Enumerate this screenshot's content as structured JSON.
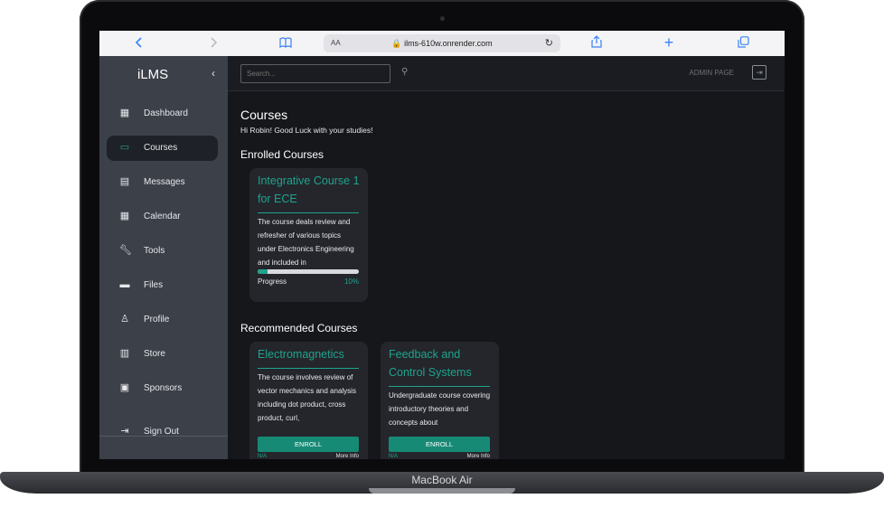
{
  "device": {
    "brand_label": "MacBook Air"
  },
  "browser": {
    "back_icon": "chevron-left-icon",
    "forward_icon": "chevron-right-icon",
    "bookmarks_icon": "book-icon",
    "text_size_label": "AA",
    "url": "🔒 ilms-610w.onrender.com",
    "reload_icon": "reload-icon",
    "share_icon": "share-icon",
    "new_tab_icon": "plus-icon",
    "tabs_icon": "tabs-icon"
  },
  "sidebar": {
    "logo": "iLMS",
    "collapse_icon": "chevron-left-icon",
    "items": [
      {
        "label": "Dashboard",
        "icon": "dashboard-icon"
      },
      {
        "label": "Courses",
        "icon": "book-icon",
        "active": true
      },
      {
        "label": "Messages",
        "icon": "message-icon"
      },
      {
        "label": "Calendar",
        "icon": "calendar-icon"
      },
      {
        "label": "Tools",
        "icon": "wrench-icon"
      },
      {
        "label": "Files",
        "icon": "folder-icon"
      },
      {
        "label": "Profile",
        "icon": "user-icon"
      },
      {
        "label": "Store",
        "icon": "store-icon"
      },
      {
        "label": "Sponsors",
        "icon": "sponsor-icon"
      }
    ],
    "sign_out": {
      "label": "Sign Out",
      "icon": "sign-out-icon"
    }
  },
  "topbar": {
    "search_placeholder": "Search...",
    "admin_label": "ADMIN PAGE",
    "logout_icon": "logout-icon"
  },
  "main": {
    "title": "Courses",
    "greeting": "Hi Robin! Good Luck with your studies!",
    "enrolled_heading": "Enrolled Courses",
    "enrolled": [
      {
        "title": "Integrative Course 1 for ECE",
        "description": "The course deals review and refresher of various topics under Electronics Engineering and included in",
        "progress_label": "Progress",
        "progress_text": "10%",
        "progress_fraction": 0.1
      }
    ],
    "recommended_heading": "Recommended Courses",
    "recommended": [
      {
        "title": "Electromagnetics",
        "description": "The course involves review of vector mechanics and analysis including dot product, cross product, curl,",
        "button": "ENROLL",
        "meta_left": "N/A",
        "meta_right": "More Info"
      },
      {
        "title": "Feedback and Control Systems",
        "description": "Undergraduate course covering introductory theories and concepts about",
        "button": "ENROLL",
        "meta_left": "N/A",
        "meta_right": "More Info"
      }
    ]
  },
  "colors": {
    "accent": "#1fa38c",
    "sidebar_bg": "#3c4049",
    "main_bg": "#15171b",
    "card_bg": "#24262c"
  }
}
